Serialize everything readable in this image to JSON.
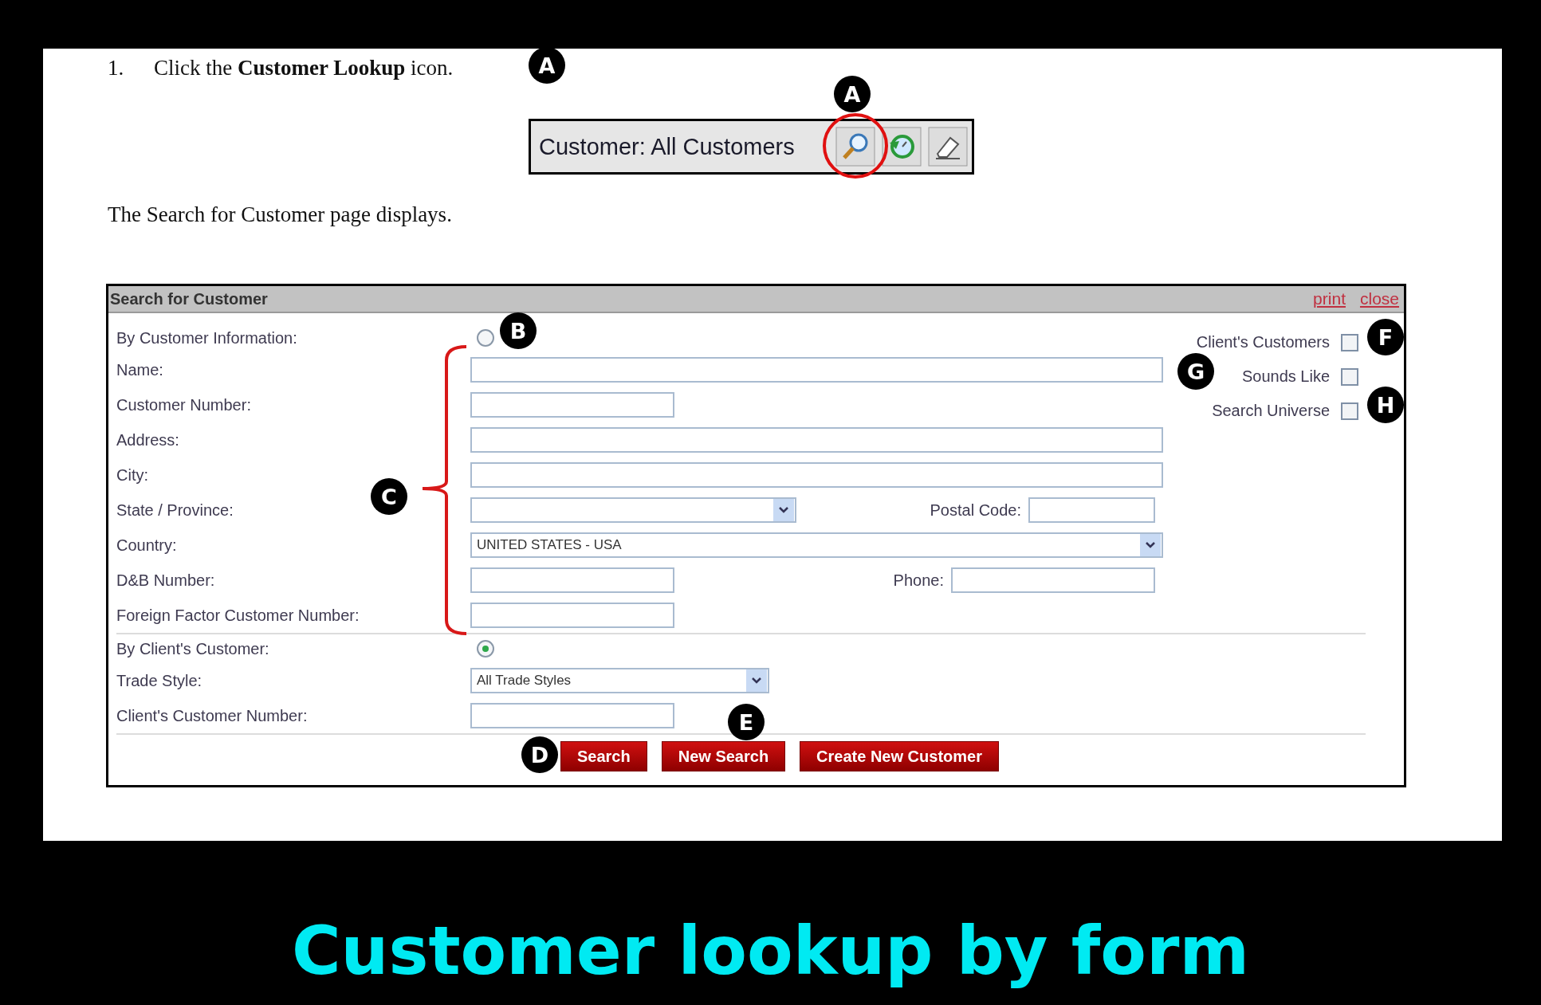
{
  "step": {
    "number": "1.",
    "text": "Click the **Customer Lookup** icon."
  },
  "toolbar": {
    "label": "Customer: All Customers"
  },
  "note": "The Search for Customer page displays.",
  "form": {
    "title": "Search for Customer",
    "links": [
      "print",
      "close"
    ],
    "sections": [
      {
        "label": "By Customer Information:",
        "selected": false,
        "rows": [
          {
            "label": "Name:",
            "kind": "text"
          },
          {
            "label": "Customer Number:",
            "kind": "short"
          },
          {
            "label": "Address:",
            "kind": "text"
          },
          {
            "label": "City:",
            "kind": "text"
          },
          {
            "label": "State / Province:",
            "kind": "select",
            "side": {
              "label": "Postal Code:"
            }
          },
          {
            "label": "Country:",
            "kind": "select-full",
            "value": "UNITED STATES - USA"
          },
          {
            "label": "D&B Number:",
            "kind": "short",
            "side": {
              "label": "Phone:"
            }
          },
          {
            "label": "Foreign Factor Customer Number:",
            "kind": "short"
          }
        ]
      },
      {
        "label": "By Client's Customer:",
        "selected": true,
        "rows": [
          {
            "label": "Trade Style:",
            "kind": "select",
            "value": "All Trade Styles"
          },
          {
            "label": "Client's Customer Number:",
            "kind": "short"
          }
        ]
      }
    ],
    "options": [
      {
        "label": "Client's Customers",
        "checked": false
      },
      {
        "label": "Sounds Like",
        "checked": false
      },
      {
        "label": "Search Universe",
        "checked": false
      }
    ],
    "buttons": [
      "Search",
      "New Search",
      "Create New Customer"
    ]
  },
  "callouts": [
    "A",
    "A",
    "B",
    "C",
    "D",
    "E",
    "F",
    "G",
    "H"
  ],
  "caption": "Customer lookup by form"
}
